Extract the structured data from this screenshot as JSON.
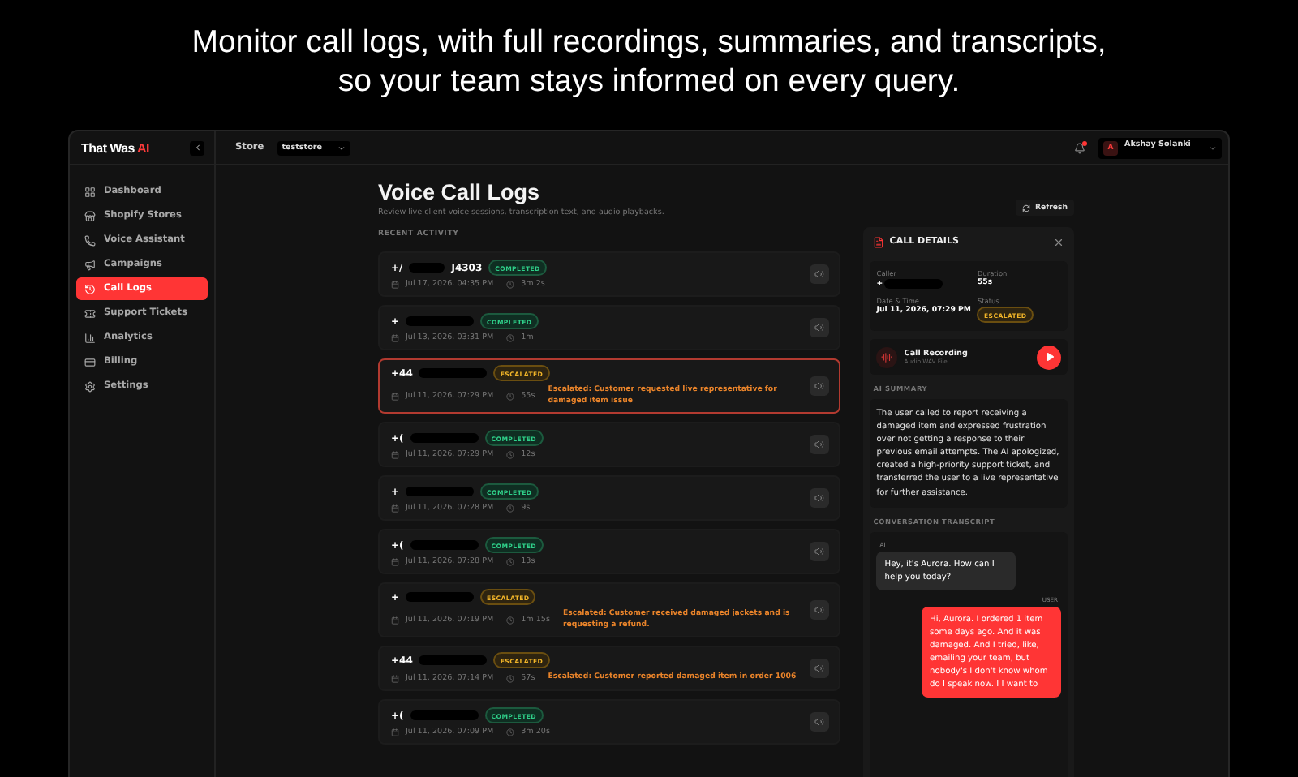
{
  "headline": [
    "Monitor call logs, with full recordings, summaries, and transcripts,",
    "so your team stays informed on every query."
  ],
  "brand": {
    "name": "That Was ",
    "accent": "AI"
  },
  "sidebar": {
    "items": [
      {
        "label": "Dashboard",
        "selected": false
      },
      {
        "label": "Shopify Stores",
        "selected": false
      },
      {
        "label": "Voice Assistant",
        "selected": false
      },
      {
        "label": "Campaigns",
        "selected": false
      },
      {
        "label": "Call Logs",
        "selected": true
      },
      {
        "label": "Support Tickets",
        "selected": false
      },
      {
        "label": "Analytics",
        "selected": false
      },
      {
        "label": "Billing",
        "selected": false
      },
      {
        "label": "Settings",
        "selected": false
      }
    ]
  },
  "topbar": {
    "store_label": "Store",
    "store_value": "teststore",
    "user": {
      "initial": "A",
      "name": "Akshay Solanki"
    },
    "notifications_unread": true
  },
  "page": {
    "title": "Voice Call Logs",
    "subtitle": "Review live client voice sessions, transcription text, and audio playbacks.",
    "refresh": "Refresh",
    "section": "RECENT ACTIVITY"
  },
  "calls": [
    {
      "phone_prefix": "+/",
      "phone_suffix": "J4303",
      "kind": "completed",
      "status_label": "COMPLETED",
      "datetime": "Jul 17, 2026, 04:35 PM",
      "duration": "3m 2s",
      "selected": false
    },
    {
      "phone_prefix": "+",
      "kind": "completed",
      "status_label": "COMPLETED",
      "datetime": "Jul 13, 2026, 03:31 PM",
      "duration": "1m",
      "selected": false
    },
    {
      "phone_prefix": "+44",
      "kind": "escalated",
      "status_label": "ESCALATED",
      "datetime": "Jul 11, 2026, 07:29 PM",
      "duration": "55s",
      "note": "Escalated: Customer requested live representative for damaged item issue",
      "selected": true
    },
    {
      "phone_prefix": "+(",
      "kind": "completed",
      "status_label": "COMPLETED",
      "datetime": "Jul 11, 2026, 07:29 PM",
      "duration": "12s",
      "selected": false
    },
    {
      "phone_prefix": "+",
      "kind": "completed",
      "status_label": "COMPLETED",
      "datetime": "Jul 11, 2026, 07:28 PM",
      "duration": "9s",
      "selected": false
    },
    {
      "phone_prefix": "+(",
      "kind": "completed",
      "status_label": "COMPLETED",
      "datetime": "Jul 11, 2026, 07:28 PM",
      "duration": "13s",
      "selected": false
    },
    {
      "phone_prefix": "+",
      "kind": "escalated",
      "status_label": "ESCALATED",
      "datetime": "Jul 11, 2026, 07:19 PM",
      "duration": "1m 15s",
      "note": "Escalated: Customer received damaged jackets and is requesting a refund.",
      "selected": false
    },
    {
      "phone_prefix": "+44",
      "kind": "escalated",
      "status_label": "ESCALATED",
      "datetime": "Jul 11, 2026, 07:14 PM",
      "duration": "57s",
      "note": "Escalated: Customer reported damaged item in order 1006",
      "selected": false
    },
    {
      "phone_prefix": "+(",
      "kind": "completed",
      "status_label": "COMPLETED",
      "datetime": "Jul 11, 2026, 07:09 PM",
      "duration": "3m 20s",
      "selected": false
    }
  ],
  "details": {
    "title": "CALL DETAILS",
    "fields": [
      {
        "label": "Caller",
        "value": "+",
        "redacted": true
      },
      {
        "label": "Duration",
        "value": "55s"
      },
      {
        "label": "Date & Time",
        "value": "Jul 11, 2026, 07:29 PM"
      },
      {
        "label": "Status",
        "badge": "ESCALATED",
        "kind": "escalated"
      }
    ],
    "recording": {
      "title": "Call Recording",
      "subtitle": "Audio WAV File"
    },
    "summary_label": "AI SUMMARY",
    "summary": "The user called to report receiving a damaged item and expressed frustration over not getting a response to their previous email attempts. The AI apologized, created a high-priority support ticket, and transferred the user to a live representative for further assistance.",
    "transcript_label": "CONVERSATION TRANSCRIPT",
    "messages": [
      {
        "kind": "ai",
        "speaker": "AI",
        "text": "Hey, it's Aurora. How can I help you today?"
      },
      {
        "kind": "user",
        "speaker": "USER",
        "text": "Hi, Aurora. I ordered 1 item some days ago. And it was damaged. And I tried, like, emailing your team, but nobody's I don't know whom do I speak now. I I want to"
      }
    ]
  }
}
